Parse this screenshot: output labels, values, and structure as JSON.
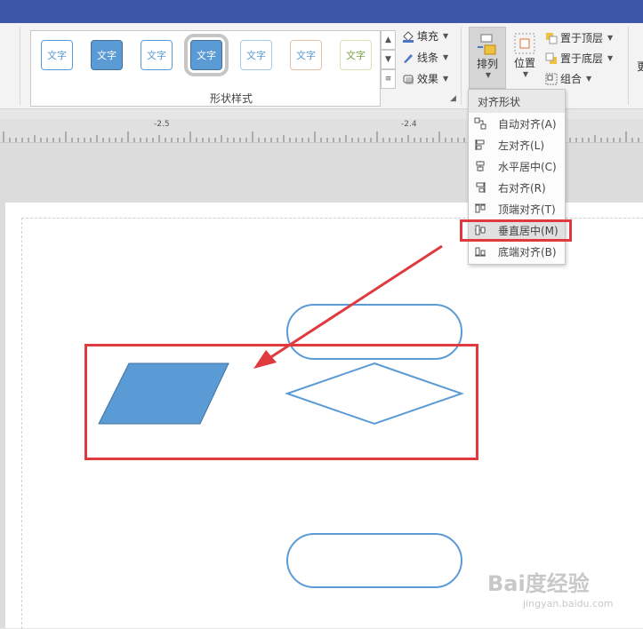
{
  "ribbon": {
    "style_gallery": [
      "文字",
      "文字",
      "文字",
      "文字",
      "文字",
      "文字",
      "文字"
    ],
    "group_label": "形状样式",
    "fill_label": "填充",
    "line_label": "线条",
    "effect_label": "效果",
    "arrange_label": "排列",
    "position_label": "位置",
    "bring_front_label": "置于顶层",
    "send_back_label": "置于底层",
    "group_shapes_label": "组合",
    "edge_text": "更"
  },
  "ruler": {
    "labels": [
      "-2.5",
      "-2.4"
    ]
  },
  "align_menu": {
    "header": "对齐形状",
    "items": [
      {
        "label": "自动对齐(A)"
      },
      {
        "label": "左对齐(L)"
      },
      {
        "label": "水平居中(C)"
      },
      {
        "label": "右对齐(R)"
      },
      {
        "label": "顶端对齐(T)"
      },
      {
        "label": "垂直居中(M)"
      },
      {
        "label": "底端对齐(B)"
      }
    ]
  },
  "colors": {
    "shape_fill": "#5b9bd5",
    "shape_stroke": "#5b9bd5",
    "highlight": "#e0393e",
    "title_bar": "#3c57a8"
  },
  "watermark": {
    "main": "Bai度经验",
    "sub": "jingyan.baidu.com"
  }
}
